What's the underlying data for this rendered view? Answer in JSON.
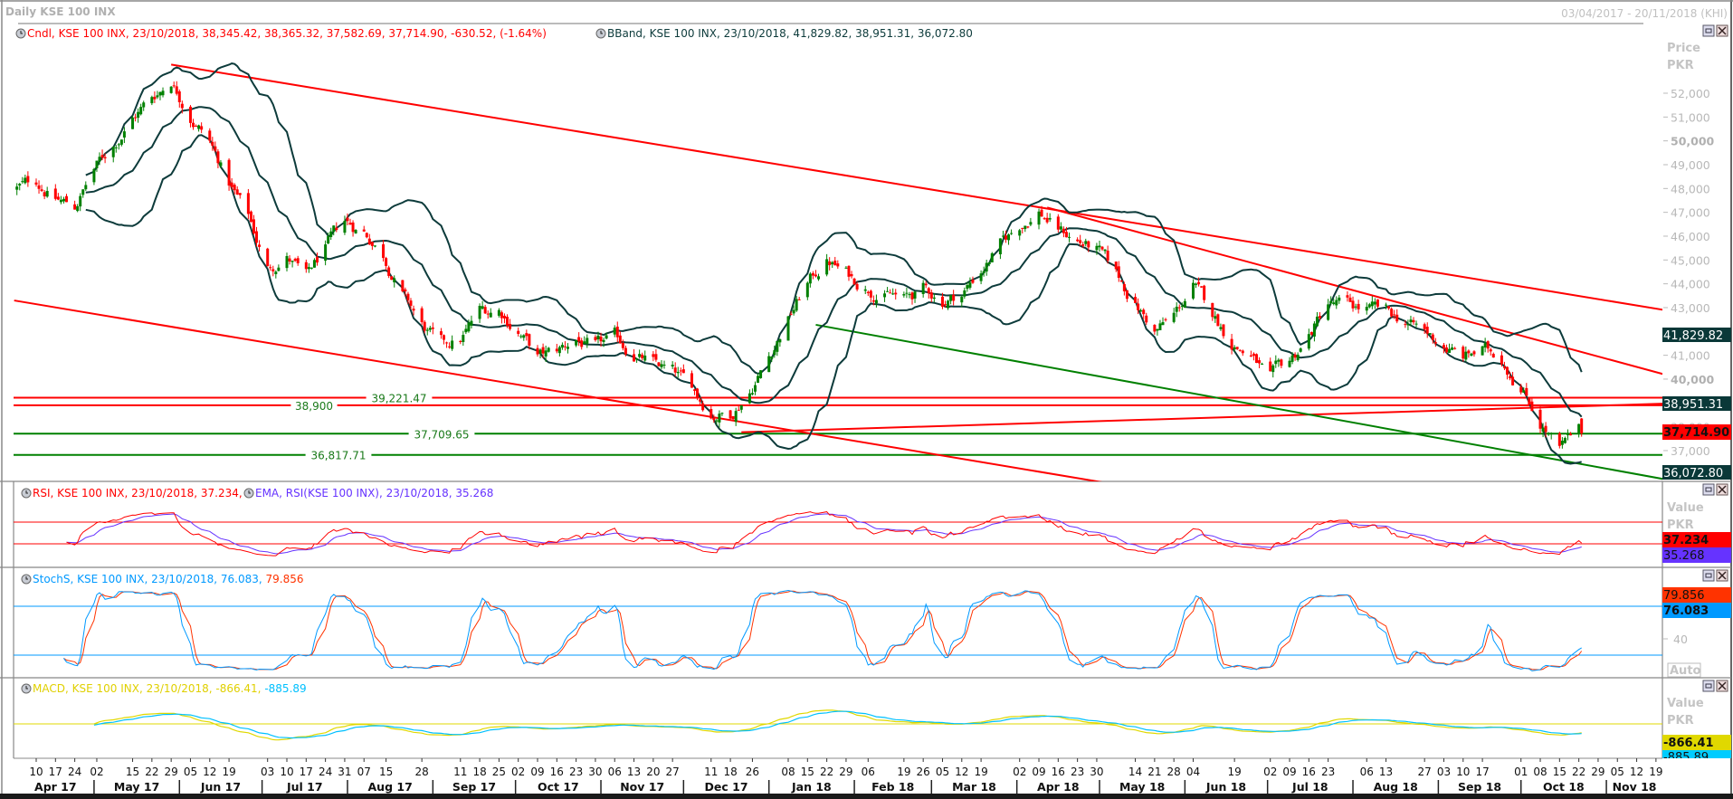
{
  "header": {
    "title": "Daily KSE 100 INX",
    "date_range": "03/04/2017 - 20/11/2018 (KHI)"
  },
  "price_pane": {
    "candle_legend": "Cndl, KSE 100 INX, 23/10/2018, 38,345.42, 38,365.32, 37,582.69, 37,714.90, -630.52, (-1.64%)",
    "bband_legend": "BBand, KSE 100 INX, 23/10/2018, 41,829.82, 38,951.31, 36,072.80",
    "axis_title": "Price",
    "axis_unit": "PKR",
    "badges": {
      "bb_upper": "41,829.82",
      "bb_mid": "38,951.31",
      "close": "37,714.90",
      "bb_lower": "36,072.80"
    },
    "level_labels": {
      "red_upper": "39,221.47",
      "red_lower": "38,900",
      "green_upper": "37,709.65",
      "green_lower": "36,817.71"
    }
  },
  "rsi_pane": {
    "legend_rsi": "RSI, KSE 100 INX, 23/10/2018, 37.234,",
    "legend_ema": "EMA, RSI(KSE 100 INX), 23/10/2018, 35.268",
    "axis_title": "Value",
    "axis_unit": "PKR",
    "badges": {
      "rsi": "37.234",
      "ema": "35.268"
    }
  },
  "stoch_pane": {
    "legend_main": "StochS, KSE 100 INX, 23/10/2018, 76.083,",
    "legend_d": "79.856",
    "badges": {
      "d": "79.856",
      "k": "76.083"
    },
    "tick_40": "40",
    "auto_label": "Auto"
  },
  "macd_pane": {
    "legend_main": "MACD, KSE 100 INX, 23/10/2018, -866.41,",
    "legend_signal": "-885.89",
    "axis_title": "Value",
    "axis_unit": "PKR",
    "badges": {
      "macd": "-866.41",
      "signal": "-885.89"
    }
  },
  "colors": {
    "up": "#008000",
    "down": "#ff0000",
    "bband": "#0d3b3b",
    "rsi": "#ff0000",
    "rsi_ema": "#6633ff",
    "stoch_k": "#0099ff",
    "stoch_d": "#ff3300",
    "macd": "#e0d800",
    "macd_signal": "#00c0ff",
    "trend_red": "#ff0000",
    "trend_green": "#008000"
  },
  "chart_data": {
    "type": "candlestick",
    "title": "Daily KSE 100 INX",
    "ylabel": "Price PKR",
    "ylim": [
      35600,
      53400
    ],
    "yticks": [
      "52,000",
      "51,000",
      "50,000",
      "49,000",
      "48,000",
      "47,000",
      "46,000",
      "45,000",
      "44,000",
      "43,000",
      "42,000",
      "41,000",
      "40,000",
      "39,000",
      "38,000",
      "37,000"
    ],
    "ytick_values": [
      52000,
      51000,
      50000,
      49000,
      48000,
      47000,
      46000,
      45000,
      44000,
      43000,
      42000,
      41000,
      40000,
      39000,
      38000,
      37000
    ],
    "weekly_close_start": "2017-04-03",
    "weekly_closes_approx": [
      48000,
      48300,
      47600,
      47200,
      48800,
      49800,
      51000,
      51800,
      52600,
      51200,
      50000,
      48200,
      46800,
      44600,
      45200,
      44200,
      45400,
      46500,
      46200,
      45300,
      43600,
      42200,
      41300,
      41600,
      42800,
      42900,
      42100,
      40900,
      41100,
      41700,
      41200,
      41600,
      41100,
      40600,
      40200,
      39600,
      38600,
      38600,
      39600,
      41000,
      42600,
      44000,
      45000,
      44400,
      43900,
      43700,
      43300,
      43700,
      43300,
      43600,
      44600,
      45600,
      46400,
      47100,
      46300,
      45800,
      45400,
      44300,
      43200,
      42000,
      42600,
      43900,
      42700,
      41600,
      41000,
      39900,
      40600,
      41800,
      43200,
      43000,
      42900,
      42700,
      42400,
      41900,
      41400,
      40900,
      41200,
      40900,
      39800,
      38300,
      37000,
      37715
    ],
    "last_candle": {
      "date": "2018-10-23",
      "open": 38345.42,
      "high": 38365.32,
      "low": 37582.69,
      "close": 37714.9,
      "change": -630.52,
      "change_pct": -1.64
    },
    "bollinger_last": {
      "upper": 41829.82,
      "middle": 38951.31,
      "lower": 36072.8
    },
    "trendlines": [
      {
        "name": "red-channel-top",
        "color": "red",
        "from": {
          "date": "2017-05-29",
          "price": 53200
        },
        "to": {
          "date": "2018-11-22",
          "price": 42900
        }
      },
      {
        "name": "red-channel-bottom",
        "color": "red",
        "from": {
          "date": "2017-04-02",
          "price": 43300
        },
        "to": {
          "date": "2018-05-02",
          "price": 35670
        }
      },
      {
        "name": "red-resistance-2018",
        "color": "red",
        "from": {
          "date": "2018-04-12",
          "price": 47200
        },
        "to": {
          "date": "2018-11-22",
          "price": 40200
        }
      },
      {
        "name": "red-rising-support",
        "color": "red",
        "from": {
          "date": "2017-12-22",
          "price": 37770
        },
        "to": {
          "date": "2018-11-22",
          "price": 38970
        }
      },
      {
        "name": "green-descending",
        "color": "green",
        "from": {
          "date": "2018-01-18",
          "price": 42280
        },
        "to": {
          "date": "2018-11-22",
          "price": 35800
        }
      }
    ],
    "horizontal_levels": [
      {
        "name": "red_upper",
        "price": 39221.47,
        "color": "red"
      },
      {
        "name": "red_lower",
        "price": 38900,
        "color": "red"
      },
      {
        "name": "green_upper",
        "price": 37709.65,
        "color": "green"
      },
      {
        "name": "green_lower",
        "price": 36817.71,
        "color": "green"
      }
    ],
    "rsi": {
      "period": 14,
      "ema_period": 9,
      "levels": [
        70,
        30
      ],
      "last": 37.234,
      "ema_last": 35.268
    },
    "stoch": {
      "levels": [
        80,
        20
      ],
      "k_last": 76.083,
      "d_last": 79.856
    },
    "macd": {
      "last": -866.41,
      "signal_last": -885.89
    },
    "x_day_ticks": [
      {
        "label": "10",
        "date": "2017-04-10"
      },
      {
        "label": "17",
        "date": "2017-04-17"
      },
      {
        "label": "24",
        "date": "2017-04-24"
      },
      {
        "label": "02",
        "date": "2017-05-02"
      },
      {
        "label": "15",
        "date": "2017-05-15"
      },
      {
        "label": "22",
        "date": "2017-05-22"
      },
      {
        "label": "29",
        "date": "2017-05-29"
      },
      {
        "label": "05",
        "date": "2017-06-05"
      },
      {
        "label": "12",
        "date": "2017-06-12"
      },
      {
        "label": "19",
        "date": "2017-06-19"
      },
      {
        "label": "03",
        "date": "2017-07-03"
      },
      {
        "label": "10",
        "date": "2017-07-10"
      },
      {
        "label": "17",
        "date": "2017-07-17"
      },
      {
        "label": "24",
        "date": "2017-07-24"
      },
      {
        "label": "31",
        "date": "2017-07-31"
      },
      {
        "label": "07",
        "date": "2017-08-07"
      },
      {
        "label": "15",
        "date": "2017-08-15"
      },
      {
        "label": "28",
        "date": "2017-08-28"
      },
      {
        "label": "11",
        "date": "2017-09-11"
      },
      {
        "label": "18",
        "date": "2017-09-18"
      },
      {
        "label": "25",
        "date": "2017-09-25"
      },
      {
        "label": "02",
        "date": "2017-10-02"
      },
      {
        "label": "09",
        "date": "2017-10-09"
      },
      {
        "label": "16",
        "date": "2017-10-16"
      },
      {
        "label": "23",
        "date": "2017-10-23"
      },
      {
        "label": "30",
        "date": "2017-10-30"
      },
      {
        "label": "06",
        "date": "2017-11-06"
      },
      {
        "label": "13",
        "date": "2017-11-13"
      },
      {
        "label": "20",
        "date": "2017-11-20"
      },
      {
        "label": "27",
        "date": "2017-11-27"
      },
      {
        "label": "11",
        "date": "2017-12-11"
      },
      {
        "label": "18",
        "date": "2017-12-18"
      },
      {
        "label": "26",
        "date": "2017-12-26"
      },
      {
        "label": "08",
        "date": "2018-01-08"
      },
      {
        "label": "15",
        "date": "2018-01-15"
      },
      {
        "label": "22",
        "date": "2018-01-22"
      },
      {
        "label": "29",
        "date": "2018-01-29"
      },
      {
        "label": "06",
        "date": "2018-02-06"
      },
      {
        "label": "19",
        "date": "2018-02-19"
      },
      {
        "label": "26",
        "date": "2018-02-26"
      },
      {
        "label": "05",
        "date": "2018-03-05"
      },
      {
        "label": "12",
        "date": "2018-03-12"
      },
      {
        "label": "19",
        "date": "2018-03-19"
      },
      {
        "label": "02",
        "date": "2018-04-02"
      },
      {
        "label": "09",
        "date": "2018-04-09"
      },
      {
        "label": "16",
        "date": "2018-04-16"
      },
      {
        "label": "23",
        "date": "2018-04-23"
      },
      {
        "label": "30",
        "date": "2018-04-30"
      },
      {
        "label": "14",
        "date": "2018-05-14"
      },
      {
        "label": "21",
        "date": "2018-05-21"
      },
      {
        "label": "28",
        "date": "2018-05-28"
      },
      {
        "label": "04",
        "date": "2018-06-04"
      },
      {
        "label": "19",
        "date": "2018-06-19"
      },
      {
        "label": "02",
        "date": "2018-07-02"
      },
      {
        "label": "09",
        "date": "2018-07-09"
      },
      {
        "label": "16",
        "date": "2018-07-16"
      },
      {
        "label": "23",
        "date": "2018-07-23"
      },
      {
        "label": "06",
        "date": "2018-08-06"
      },
      {
        "label": "13",
        "date": "2018-08-13"
      },
      {
        "label": "27",
        "date": "2018-08-27"
      },
      {
        "label": "03",
        "date": "2018-09-03"
      },
      {
        "label": "10",
        "date": "2018-09-10"
      },
      {
        "label": "17",
        "date": "2018-09-17"
      },
      {
        "label": "01",
        "date": "2018-10-01"
      },
      {
        "label": "08",
        "date": "2018-10-08"
      },
      {
        "label": "15",
        "date": "2018-10-15"
      },
      {
        "label": "22",
        "date": "2018-10-22"
      },
      {
        "label": "29",
        "date": "2018-10-29"
      },
      {
        "label": "05",
        "date": "2018-11-05"
      },
      {
        "label": "12",
        "date": "2018-11-12"
      },
      {
        "label": "19",
        "date": "2018-11-19"
      }
    ],
    "x_months": [
      {
        "label": "Apr 17",
        "start": "2017-04-03",
        "end": "2017-05-01"
      },
      {
        "label": "May 17",
        "start": "2017-05-01",
        "end": "2017-06-01"
      },
      {
        "label": "Jun 17",
        "start": "2017-06-01",
        "end": "2017-07-01"
      },
      {
        "label": "Jul 17",
        "start": "2017-07-01",
        "end": "2017-08-01"
      },
      {
        "label": "Aug 17",
        "start": "2017-08-01",
        "end": "2017-09-01"
      },
      {
        "label": "Sep 17",
        "start": "2017-09-01",
        "end": "2017-10-01"
      },
      {
        "label": "Oct 17",
        "start": "2017-10-01",
        "end": "2017-11-01"
      },
      {
        "label": "Nov 17",
        "start": "2017-11-01",
        "end": "2017-12-01"
      },
      {
        "label": "Dec 17",
        "start": "2017-12-01",
        "end": "2018-01-01"
      },
      {
        "label": "Jan 18",
        "start": "2018-01-01",
        "end": "2018-02-01"
      },
      {
        "label": "Feb 18",
        "start": "2018-02-01",
        "end": "2018-03-01"
      },
      {
        "label": "Mar 18",
        "start": "2018-03-01",
        "end": "2018-04-01"
      },
      {
        "label": "Apr 18",
        "start": "2018-04-01",
        "end": "2018-05-01"
      },
      {
        "label": "May 18",
        "start": "2018-05-01",
        "end": "2018-06-01"
      },
      {
        "label": "Jun 18",
        "start": "2018-06-01",
        "end": "2018-07-01"
      },
      {
        "label": "Jul 18",
        "start": "2018-07-01",
        "end": "2018-08-01"
      },
      {
        "label": "Aug 18",
        "start": "2018-08-01",
        "end": "2018-09-01"
      },
      {
        "label": "Sep 18",
        "start": "2018-09-01",
        "end": "2018-10-01"
      },
      {
        "label": "Oct 18",
        "start": "2018-10-01",
        "end": "2018-11-01"
      },
      {
        "label": "Nov 18",
        "start": "2018-11-01",
        "end": "2018-11-24"
      }
    ]
  }
}
